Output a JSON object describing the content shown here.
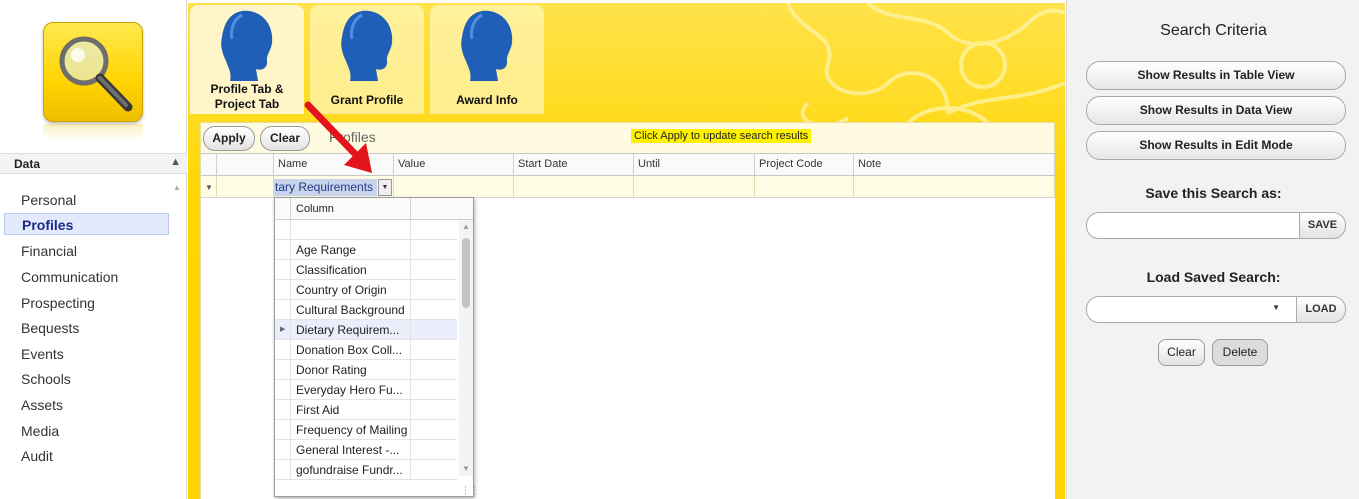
{
  "sidebar": {
    "section_title": "Data",
    "items": [
      {
        "label": "Personal"
      },
      {
        "label": "Profiles"
      },
      {
        "label": "Financial"
      },
      {
        "label": "Communication"
      },
      {
        "label": "Prospecting"
      },
      {
        "label": "Bequests"
      },
      {
        "label": "Events"
      },
      {
        "label": "Schools"
      },
      {
        "label": "Assets"
      },
      {
        "label": "Media"
      },
      {
        "label": "Audit"
      }
    ],
    "active_item": "Profiles"
  },
  "tabs": [
    {
      "label_line1": "Profile Tab &",
      "label_line2": "Project Tab",
      "icon": "person-head-icon"
    },
    {
      "label_line1": "Grant Profile",
      "label_line2": "",
      "icon": "person-head-icon"
    },
    {
      "label_line1": "Award Info",
      "label_line2": "",
      "icon": "person-head-icon"
    }
  ],
  "toolbar": {
    "apply_label": "Apply",
    "clear_label": "Clear",
    "panel_title": "Profiles",
    "hint": "Click Apply to update search results"
  },
  "grid": {
    "columns": [
      "Name",
      "Value",
      "Start Date",
      "Until",
      "Project Code",
      "Note"
    ],
    "name_filter_value": "tary Requirements"
  },
  "dropdown": {
    "header": "Column",
    "items": [
      "",
      "Age Range",
      "Classification",
      "Country of Origin",
      "Cultural Background",
      "Dietary Requirem...",
      "Donation Box Coll...",
      "Donor Rating",
      "Everyday Hero Fu...",
      "First Aid",
      "Frequency of Mailing",
      "General Interest -...",
      "gofundraise Fundr..."
    ],
    "selected": "Dietary Requirem..."
  },
  "right_panel": {
    "title": "Search Criteria",
    "table_view_label": "Show Results in Table View",
    "data_view_label": "Show Results in Data View",
    "edit_mode_label": "Show Results in Edit Mode",
    "save_search_label": "Save this Search as:",
    "save_button": "SAVE",
    "load_search_label": "Load Saved Search:",
    "load_button": "LOAD",
    "clear_label": "Clear",
    "delete_label": "Delete"
  },
  "colors": {
    "accent_yellow": "#ffd600",
    "head_blue": "#1f5fb8",
    "arrow_red": "#e3141b",
    "active_nav": "#1b2a8c"
  }
}
